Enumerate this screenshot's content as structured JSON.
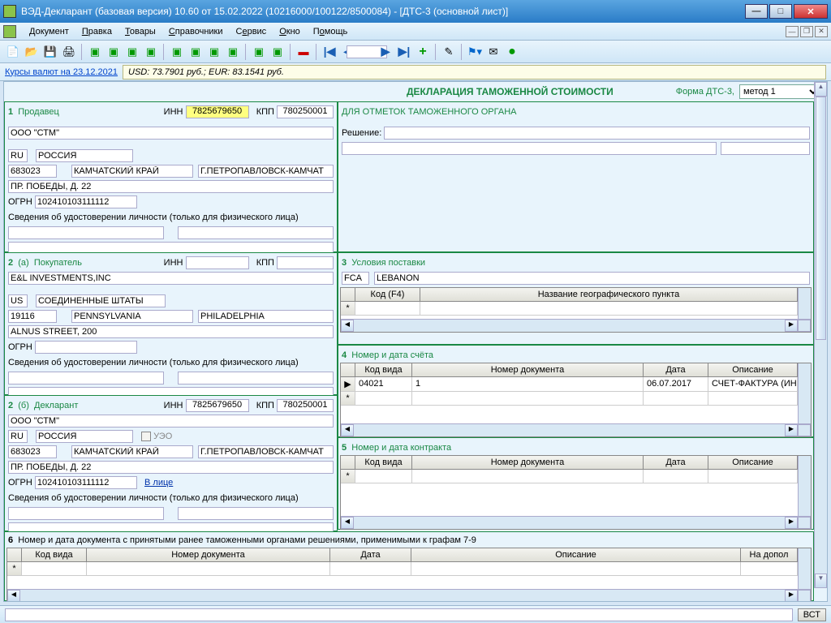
{
  "window": {
    "title": "ВЭД-Декларант (базовая версия) 10.60 от 15.02.2022  (10216000/100122/8500084) - [ДТС-3 (основной лист)]"
  },
  "menu": {
    "items": [
      "Документ",
      "Правка",
      "Товары",
      "Справочники",
      "Сервис",
      "Окно",
      "Помощь"
    ]
  },
  "ratebar": {
    "link": "Курсы валют на 23.12.2021",
    "rates": "USD: 73.7901 руб.; EUR: 83.1541 руб."
  },
  "header": {
    "title": "ДЕКЛАРАЦИЯ ТАМОЖЕННОЙ СТОИМОСТИ",
    "form_label": "Форма ДТС-3,",
    "method": "метод 1"
  },
  "seller": {
    "num": "1",
    "label": "Продавец",
    "inn_label": "ИНН",
    "inn": "7825679650",
    "kpp_label": "КПП",
    "kpp": "780250001",
    "name": "ООО \"СТМ\"",
    "cc": "RU",
    "country": "РОССИЯ",
    "zip": "683023",
    "region": "КАМЧАТСКИЙ КРАЙ",
    "city": "Г.ПЕТРОПАВЛОВСК-КАМЧАТ",
    "addr": "ПР. ПОБЕДЫ, Д. 22",
    "ogrn_label": "ОГРН",
    "ogrn": "102410103111112",
    "id_note": "Сведения об удостоверении личности (только для физического лица)"
  },
  "buyer": {
    "num": "2",
    "sub": "(а)",
    "label": "Покупатель",
    "inn_label": "ИНН",
    "kpp_label": "КПП",
    "name": "E&L INVESTMENTS,INC",
    "cc": "US",
    "country": "СОЕДИНЕННЫЕ ШТАТЫ",
    "zip": "19116",
    "region": "PENNSYLVANIA",
    "city": "PHILADELPHIA",
    "addr": "ALNUS STREET, 200",
    "ogrn_label": "ОГРН",
    "id_note": "Сведения об удостоверении личности (только для физического лица)"
  },
  "declarant": {
    "num": "2",
    "sub": "(б)",
    "label": "Декларант",
    "inn_label": "ИНН",
    "inn": "7825679650",
    "kpp_label": "КПП",
    "kpp": "780250001",
    "name": "ООО \"СТМ\"",
    "cc": "RU",
    "country": "РОССИЯ",
    "ueo": "УЭО",
    "zip": "683023",
    "region": "КАМЧАТСКИЙ КРАЙ",
    "city": "Г.ПЕТРОПАВЛОВСК-КАМЧАТ",
    "addr": "ПР. ПОБЕДЫ, Д. 22",
    "ogrn_label": "ОГРН",
    "ogrn": "102410103111112",
    "vlitse": "В лице",
    "id_note": "Сведения об удостоверении личности (только для физического лица)"
  },
  "customs_marks": {
    "title": "ДЛЯ ОТМЕТОК ТАМОЖЕННОГО ОРГАНА",
    "decision": "Решение:"
  },
  "delivery": {
    "num": "3",
    "label": "Условия поставки",
    "term": "FCA",
    "place": "LEBANON",
    "col_code": "Код (F4)",
    "col_name": "Название географического пункта"
  },
  "invoice": {
    "num": "4",
    "label": "Номер и дата счёта",
    "cols": {
      "code": "Код вида",
      "docnum": "Номер документа",
      "date": "Дата",
      "desc": "Описание"
    },
    "row": {
      "code": "04021",
      "docnum": "1",
      "date": "06.07.2017",
      "desc": "СЧЕТ-ФАКТУРА (ИНВ"
    }
  },
  "contract": {
    "num": "5",
    "label": "Номер и дата контракта",
    "cols": {
      "code": "Код вида",
      "docnum": "Номер документа",
      "date": "Дата",
      "desc": "Описание"
    }
  },
  "section6": {
    "num": "6",
    "label": "Номер и дата документа с принятыми ранее таможенными органами решениями, применимыми к графам 7-9",
    "cols": {
      "code": "Код вида",
      "docnum": "Номер документа",
      "date": "Дата",
      "desc": "Описание",
      "extra": "На допол"
    }
  },
  "statusbar": {
    "mode": "ВСТ"
  }
}
